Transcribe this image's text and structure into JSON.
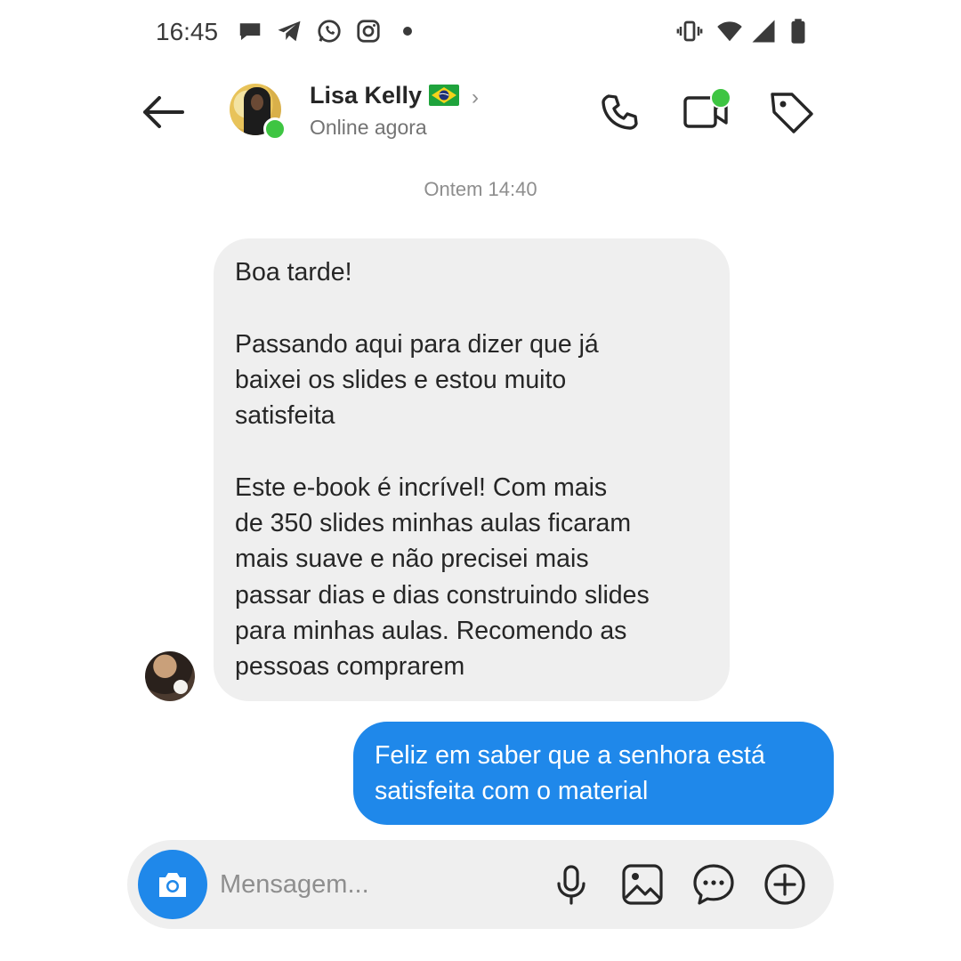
{
  "status_bar": {
    "time": "16:45",
    "icons": [
      "chat-bubble-icon",
      "telegram-icon",
      "whatsapp-icon",
      "instagram-icon",
      "dot-icon",
      "vibrate-icon",
      "wifi-icon",
      "signal-icon",
      "battery-icon"
    ]
  },
  "header": {
    "contact_name": "Lisa Kelly",
    "flag_emoji": "🇧🇷",
    "status": "Online agora",
    "accent_online": "#3ec542",
    "icons": [
      "back-arrow-icon",
      "phone-icon",
      "video-icon",
      "tag-icon"
    ]
  },
  "conversation": {
    "timestamp": "Ontem 14:40",
    "messages": [
      {
        "direction": "incoming",
        "text": "Boa tarde!\n\nPassando aqui para dizer que já\nbaixei os slides e estou muito\nsatisfeita\n\nEste e-book é incrível! Com mais\nde 350 slides minhas aulas ficaram\nmais suave e não precisei mais\npassar dias e dias construindo slides\npara minhas aulas. Recomendo as\npessoas comprarem"
      },
      {
        "direction": "outgoing",
        "text": "Feliz em saber que a senhora está\nsatisfeita com o material"
      }
    ]
  },
  "composer": {
    "placeholder": "Mensagem...",
    "icons": [
      "camera-icon",
      "microphone-icon",
      "gallery-icon",
      "sticker-icon",
      "plus-icon"
    ]
  },
  "colors": {
    "outgoing_bubble": "#1f88ea",
    "incoming_bubble": "#efefef",
    "composer_bg": "#efefef"
  }
}
